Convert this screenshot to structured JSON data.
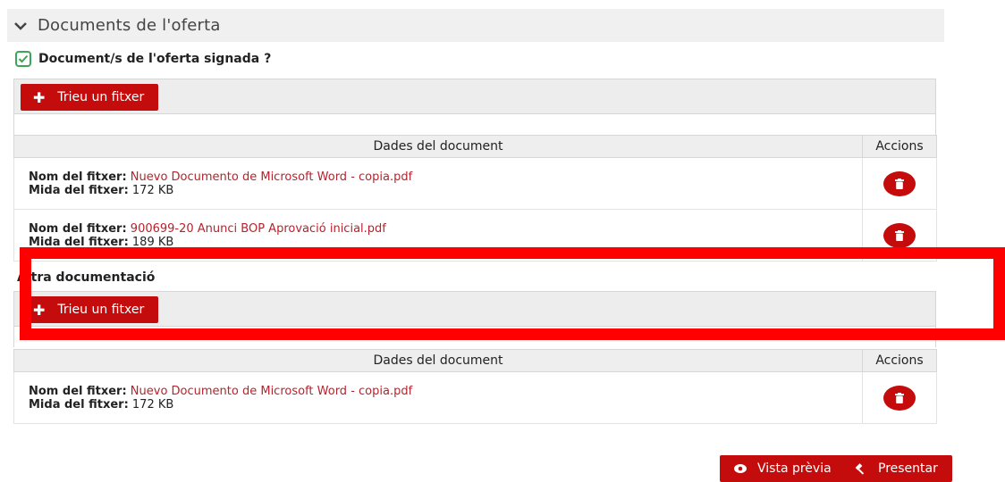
{
  "section": {
    "title": "Documents de l'oferta"
  },
  "signed_docs": {
    "label": "Document/s de l'oferta signada",
    "help": "?",
    "upload_label": "Trieu un fitxer",
    "table_headers": {
      "data": "Dades del document",
      "actions": "Accions"
    },
    "files": [
      {
        "name_label": "Nom del fitxer:",
        "name": "Nuevo Documento de Microsoft Word - copia.pdf",
        "size_label": "Mida del fitxer:",
        "size": "172 KB"
      },
      {
        "name_label": "Nom del fitxer:",
        "name": "900699-20 Anunci BOP Aprovació inicial.pdf",
        "size_label": "Mida del fitxer:",
        "size": "189 KB"
      }
    ]
  },
  "other_docs": {
    "label": "Altra documentació",
    "upload_label": "Trieu un fitxer",
    "table_headers": {
      "data": "Dades del document",
      "actions": "Accions"
    },
    "files": [
      {
        "name_label": "Nom del fitxer:",
        "name": "Nuevo Documento de Microsoft Word - copia.pdf",
        "size_label": "Mida del fitxer:",
        "size": "172 KB"
      }
    ]
  },
  "footer": {
    "preview_label": "Vista prèvia",
    "submit_label": "Presentar"
  },
  "colors": {
    "primary_red": "#c40c0c",
    "highlight": "#ff0000",
    "check_green": "#3aa657",
    "link_red": "#b8222c"
  },
  "icons": [
    "chevron-down-icon",
    "checkbox-checked-icon",
    "plus-icon",
    "trash-icon",
    "eye-icon",
    "gavel-icon"
  ]
}
